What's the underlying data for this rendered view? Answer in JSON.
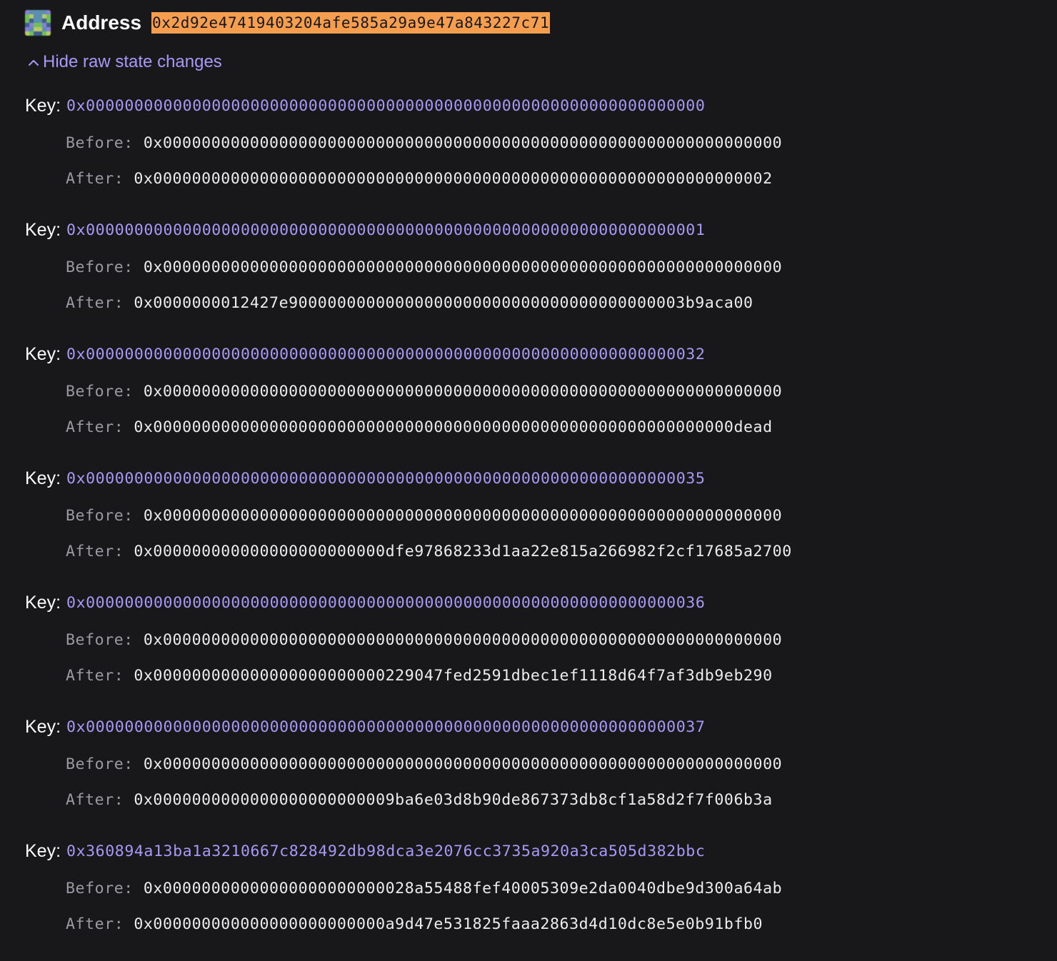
{
  "address": {
    "label": "Address",
    "value": "0x2d92e47419403204afe585a29a9e47a843227c71",
    "identicon": "blockie-identicon"
  },
  "toggle": {
    "icon": "chevron-up-icon",
    "label": "Hide raw state changes"
  },
  "labels": {
    "key": "Key:",
    "before": "Before:",
    "after": "After:"
  },
  "changes": [
    {
      "key": "0x0000000000000000000000000000000000000000000000000000000000000000",
      "before": "0x0000000000000000000000000000000000000000000000000000000000000000",
      "after": "0x0000000000000000000000000000000000000000000000000000000000000002"
    },
    {
      "key": "0x0000000000000000000000000000000000000000000000000000000000000001",
      "before": "0x0000000000000000000000000000000000000000000000000000000000000000",
      "after": "0x0000000012427e90000000000000000000000000000000000000003b9aca00"
    },
    {
      "key": "0x0000000000000000000000000000000000000000000000000000000000000032",
      "before": "0x0000000000000000000000000000000000000000000000000000000000000000",
      "after": "0x000000000000000000000000000000000000000000000000000000000000dead"
    },
    {
      "key": "0x0000000000000000000000000000000000000000000000000000000000000035",
      "before": "0x0000000000000000000000000000000000000000000000000000000000000000",
      "after": "0x000000000000000000000000dfe97868233d1aa22e815a266982f2cf17685a2700"
    },
    {
      "key": "0x0000000000000000000000000000000000000000000000000000000000000036",
      "before": "0x0000000000000000000000000000000000000000000000000000000000000000",
      "after": "0x000000000000000000000000229047fed2591dbec1ef1118d64f7af3db9eb290"
    },
    {
      "key": "0x0000000000000000000000000000000000000000000000000000000000000037",
      "before": "0x0000000000000000000000000000000000000000000000000000000000000000",
      "after": "0x0000000000000000000000009ba6e03d8b90de867373db8cf1a58d2f7f006b3a"
    },
    {
      "key": "0x360894a13ba1a3210667c828492db98dca3e2076cc3735a920a3ca505d382bbc",
      "before": "0x00000000000000000000000028a55488fef40005309e2da0040dbe9d300a64ab",
      "after": "0x000000000000000000000000a9d47e531825faaa2863d4d10dc8e5e0b91bfb0"
    }
  ],
  "colors": {
    "background": "#18181b",
    "accent": "#a799f5",
    "address_highlight": "#f59e4f",
    "muted_label": "#9a9aa2",
    "value_text": "#ececef"
  }
}
